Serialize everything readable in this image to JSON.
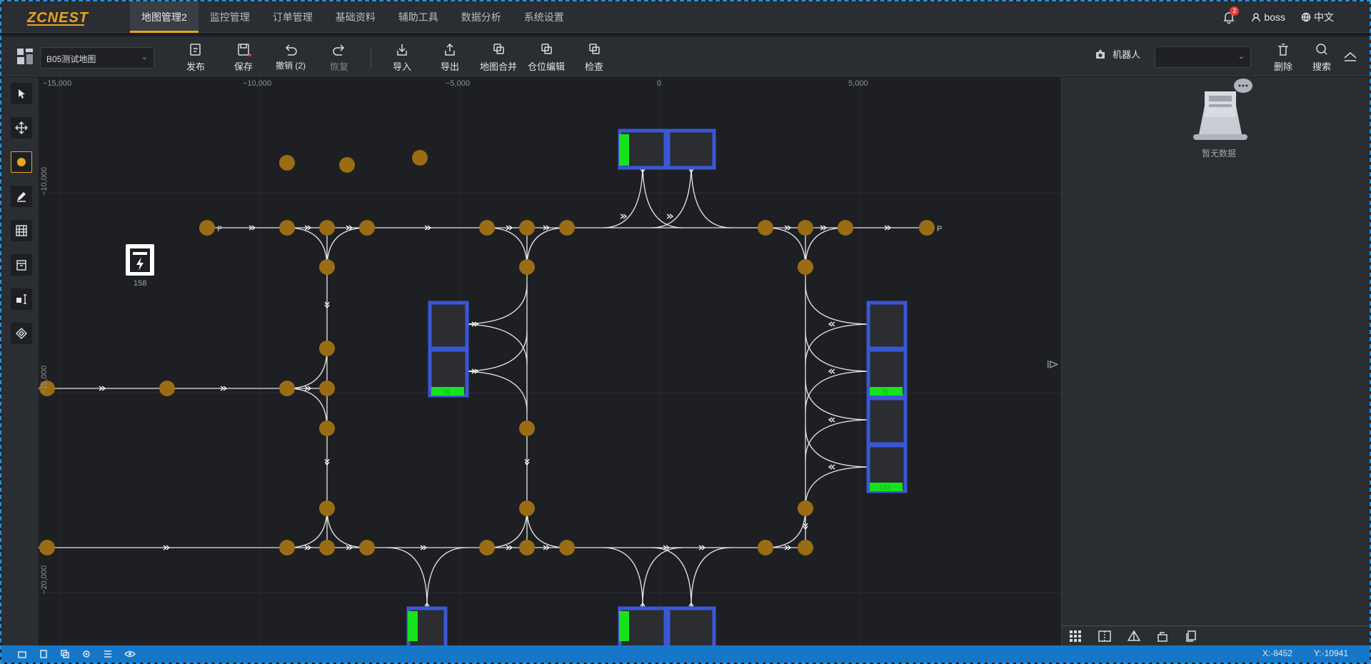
{
  "brand": {
    "logo_text": "ZCNEST"
  },
  "nav": {
    "tabs": [
      "地图管理2",
      "监控管理",
      "订单管理",
      "基础资料",
      "辅助工具",
      "数据分析",
      "系统设置"
    ],
    "active_index": 0,
    "notification_count": "2",
    "user": "boss",
    "language": "中文"
  },
  "toolbar": {
    "map_select_value": "B05测试地图",
    "buttons": {
      "publish": "发布",
      "save": "保存",
      "undo": "撤销 (2)",
      "redo": "恢复",
      "import": "导入",
      "export": "导出",
      "merge": "地图合并",
      "slot_edit": "仓位编辑",
      "check": "检查",
      "delete": "删除",
      "search": "搜索"
    },
    "robot_label": "机器人",
    "robot_select_value": ""
  },
  "left_tools": [
    "select-tool",
    "move-tool",
    "point-tool",
    "pen-tool",
    "shelf-tool",
    "storage-tool",
    "label-tool",
    "area-tool"
  ],
  "ruler": {
    "x_ticks": [
      "−15,000",
      "−10,000",
      "−5,000",
      "0",
      "5,000"
    ],
    "y_ticks": [
      "−10,000",
      "−15,000",
      "−20,000"
    ]
  },
  "map": {
    "charger_id": "158",
    "path_end_label": "P",
    "slot_labels": {
      "left_mid": "76",
      "right_mid": "75",
      "right_low": "143"
    }
  },
  "right_panel": {
    "empty_text": "暂无数据"
  },
  "status": {
    "x": "X:-8452",
    "y": "Y:-10941"
  },
  "colors": {
    "accent": "#e8a520",
    "status_bar": "#1677c8",
    "shelf": "#3b57d6",
    "slot_green": "#16e31e",
    "node": "#9a6d14"
  }
}
